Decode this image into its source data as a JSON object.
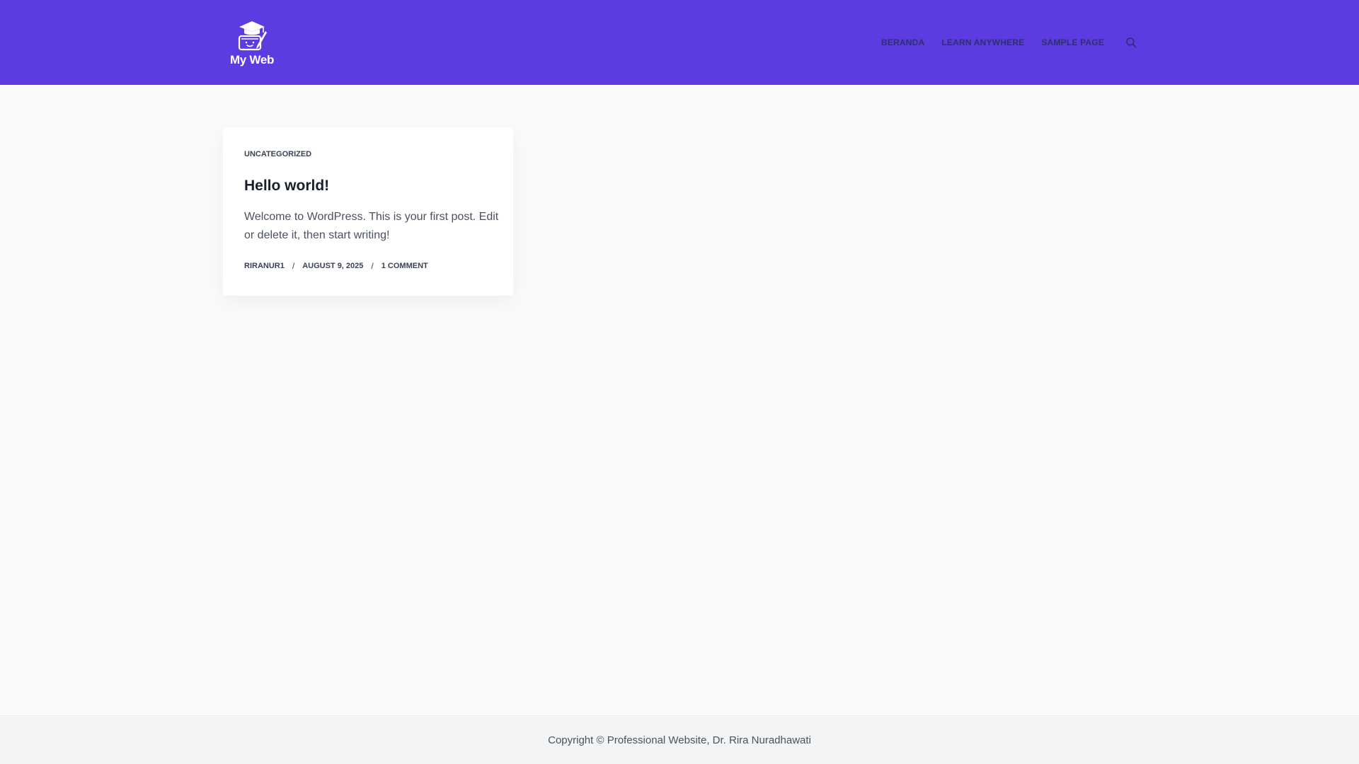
{
  "site": {
    "logo_text": "My Web",
    "header_bg": "#5c3be0"
  },
  "nav": {
    "items": [
      {
        "label": "Beranda"
      },
      {
        "label": "Learn Anywhere"
      },
      {
        "label": "Sample Page"
      }
    ],
    "search_icon": "search-icon"
  },
  "post": {
    "category": "Uncategorized",
    "title": "Hello world!",
    "excerpt": "Welcome to WordPress. This is your first post. Edit or delete it, then start writing!",
    "author": "riranur1",
    "date": "August 9, 2025",
    "comments": "1 Comment",
    "separator": "/"
  },
  "footer": {
    "copyright": "Copyright © Professional Website, Dr. Rira Nuradhawati"
  }
}
